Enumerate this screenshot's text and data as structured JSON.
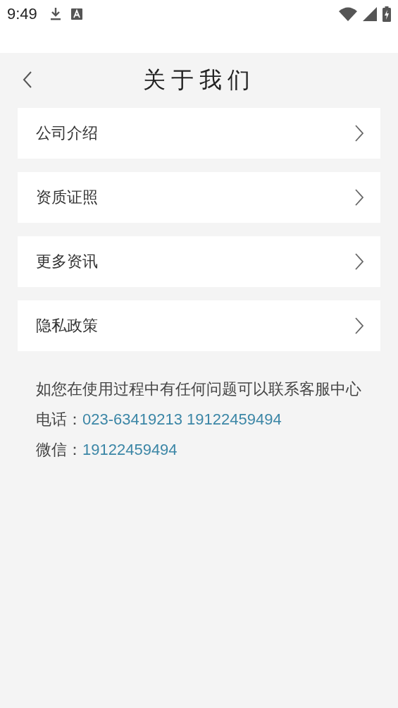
{
  "status_bar": {
    "time": "9:49"
  },
  "header": {
    "title": "关于我们"
  },
  "menu_items": [
    {
      "label": "公司介绍"
    },
    {
      "label": "资质证照"
    },
    {
      "label": "更多资讯"
    },
    {
      "label": "隐私政策"
    }
  ],
  "contact": {
    "intro": "如您在使用过程中有任何问题可以联系客服中心",
    "phone_label": "电话：",
    "phone": "023-63419213 19122459494",
    "wechat_label": "微信：",
    "wechat": "19122459494"
  }
}
